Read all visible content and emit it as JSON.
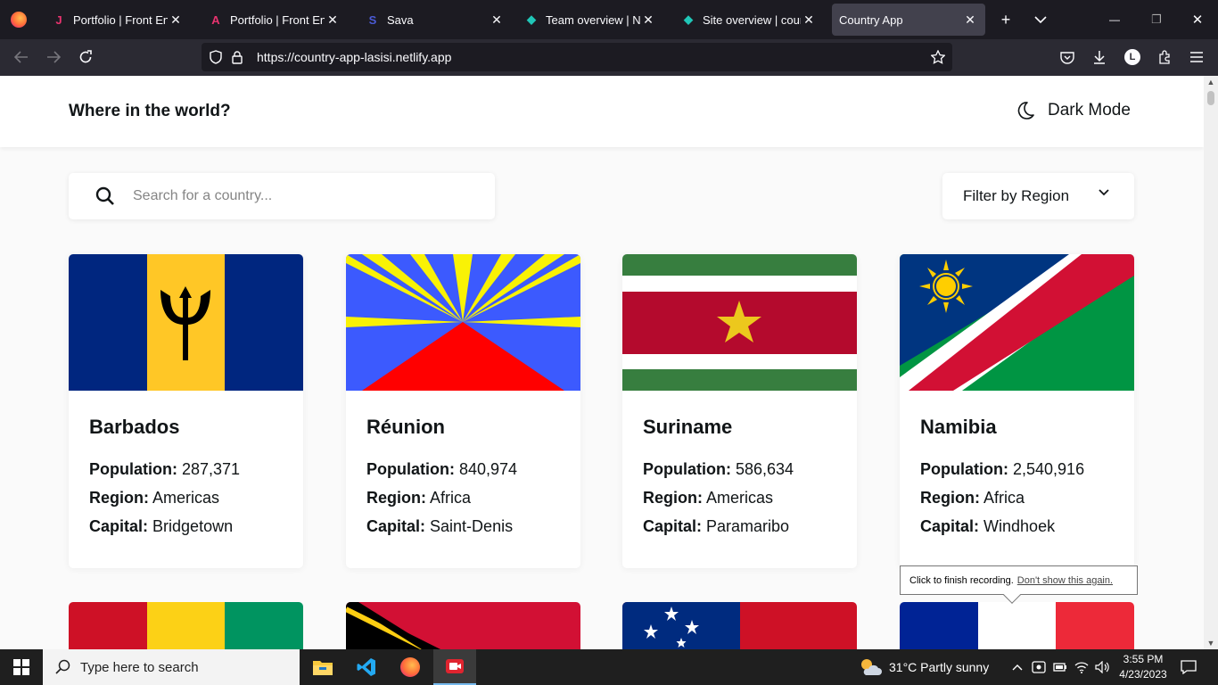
{
  "browser": {
    "tabs": [
      {
        "title": "Portfolio | Front End De",
        "icon": "J",
        "icon_color": "#e8336f",
        "close": "✕"
      },
      {
        "title": "Portfolio | Front End De",
        "icon": "A",
        "icon_color": "#e8336f",
        "close": "✕"
      },
      {
        "title": "Sava",
        "icon": "S",
        "icon_color": "#4b5bd6",
        "close": "✕"
      },
      {
        "title": "Team overview | Netlify",
        "icon": "◆",
        "icon_color": "#20c6b7",
        "close": "✕"
      },
      {
        "title": "Site overview | country",
        "icon": "◆",
        "icon_color": "#20c6b7",
        "close": "✕"
      },
      {
        "title": "Country App",
        "icon": "",
        "icon_color": "",
        "close": "✕"
      }
    ],
    "url": "https://country-app-lasisi.netlify.app",
    "new_tab": "+",
    "list_all_tabs": "⌄",
    "minimize": "—",
    "restore": "❐",
    "close": "✕"
  },
  "app": {
    "brand": "Where in the world?",
    "dark_mode_label": "Dark Mode",
    "search": {
      "placeholder": "Search for a country..."
    },
    "filter_label": "Filter by Region",
    "labels": {
      "population": "Population:",
      "region": "Region:",
      "capital": "Capital:"
    },
    "countries": [
      {
        "name": "Barbados",
        "population": "287,371",
        "region": "Americas",
        "capital": "Bridgetown"
      },
      {
        "name": "Réunion",
        "population": "840,974",
        "region": "Africa",
        "capital": "Saint-Denis"
      },
      {
        "name": "Suriname",
        "population": "586,634",
        "region": "Americas",
        "capital": "Paramaribo"
      },
      {
        "name": "Namibia",
        "population": "2,540,916",
        "region": "Africa",
        "capital": "Windhoek"
      }
    ]
  },
  "tooltip": {
    "text": "Click to finish recording.",
    "link": "Don't show this again."
  },
  "taskbar": {
    "search_placeholder": "Type here to search",
    "weather": "31°C  Partly sunny",
    "time": "3:55 PM",
    "date": "4/23/2023",
    "apps": [
      "file-explorer-icon",
      "vscode-icon",
      "firefox-icon",
      "recorder-icon"
    ]
  }
}
